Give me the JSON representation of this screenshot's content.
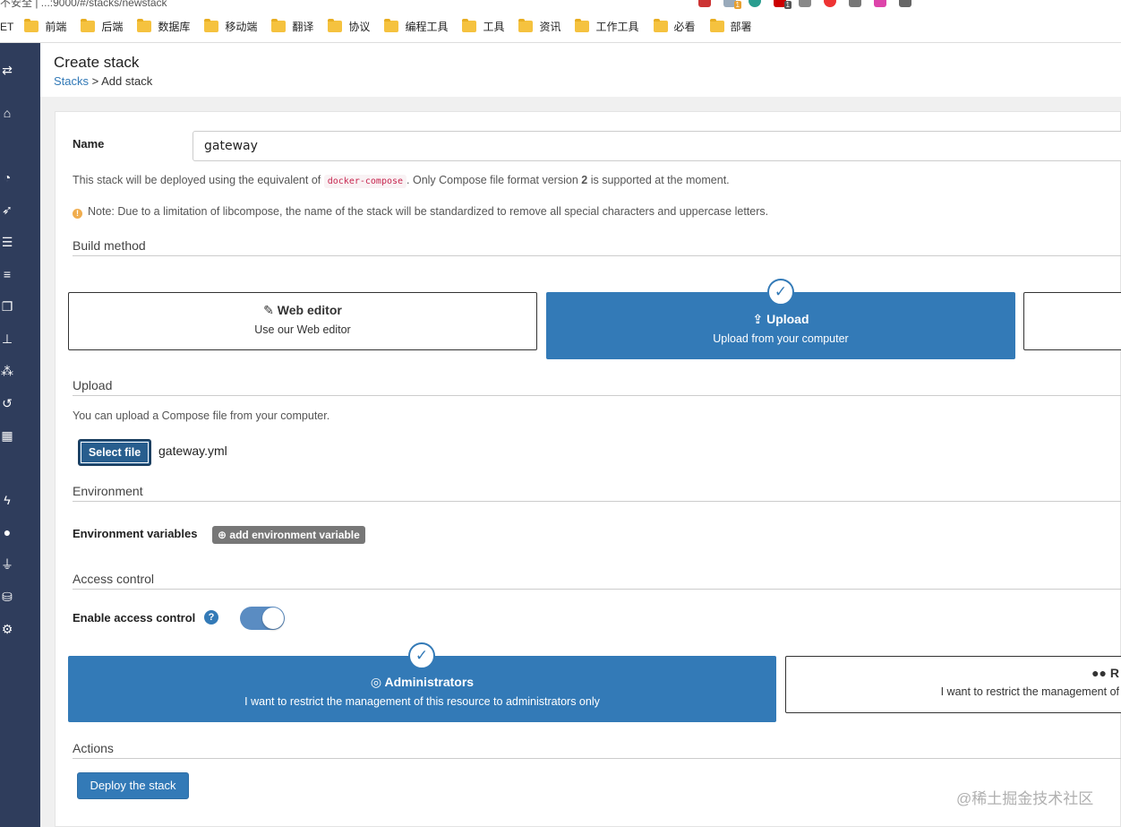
{
  "browser": {
    "address_fragment": "不安全  |  ...:9000/#/stacks/newstack",
    "extension_badges": [
      "1",
      "1"
    ],
    "bookmarks_leading_fragment": "ET",
    "bookmarks": [
      "前端",
      "后端",
      "数据库",
      "移动端",
      "翻译",
      "协议",
      "编程工具",
      "工具",
      "资讯",
      "工作工具",
      "必看",
      "部署"
    ]
  },
  "sidebar": {
    "icons": [
      "exchange-icon",
      "home-icon",
      "dashboard-icon",
      "rocket-icon",
      "th-list-icon",
      "server-icon",
      "clone-icon",
      "sitemap-icon",
      "cubes-icon",
      "history-icon",
      "th-icon",
      "bolt-icon",
      "users-icon",
      "plug-icon",
      "database-icon",
      "cogs-icon"
    ]
  },
  "header": {
    "title": "Create stack",
    "breadcrumb_link": "Stacks",
    "breadcrumb_sep": " > ",
    "breadcrumb_current": "Add stack"
  },
  "form": {
    "name_label": "Name",
    "name_value": "gateway",
    "help_prefix": "This stack will be deployed using the equivalent of",
    "help_code": "docker-compose",
    "help_mid": ". Only Compose file format version",
    "help_version": "2",
    "help_suffix": "is supported at the moment.",
    "note": "Note: Due to a limitation of libcompose, the name of the stack will be standardized to remove all special characters and uppercase letters."
  },
  "build_method": {
    "section_title": "Build method",
    "options": [
      {
        "title": "Web editor",
        "desc": "Use our Web editor",
        "selected": false
      },
      {
        "title": "Upload",
        "desc": "Upload from your computer",
        "selected": true
      }
    ]
  },
  "upload": {
    "section_title": "Upload",
    "help": "You can upload a Compose file from your computer.",
    "select_button": "Select file",
    "filename": "gateway.yml"
  },
  "environment": {
    "section_title": "Environment",
    "label": "Environment variables",
    "add_button": "add environment variable"
  },
  "access_control": {
    "section_title": "Access control",
    "enable_label": "Enable access control",
    "enabled": true,
    "options": [
      {
        "title": "Administrators",
        "desc": "I want to restrict the management of this resource to administrators only",
        "selected": true
      },
      {
        "title": "R",
        "desc": "I want to restrict the management of",
        "selected": false
      }
    ]
  },
  "actions": {
    "section_title": "Actions",
    "deploy_button": "Deploy the stack"
  },
  "watermark": "@稀土掘金技术社区",
  "colors": {
    "sidebar": "#2f3d5c",
    "primary": "#337ab7",
    "code": "#c7254e",
    "warning": "#f0ad4e"
  }
}
